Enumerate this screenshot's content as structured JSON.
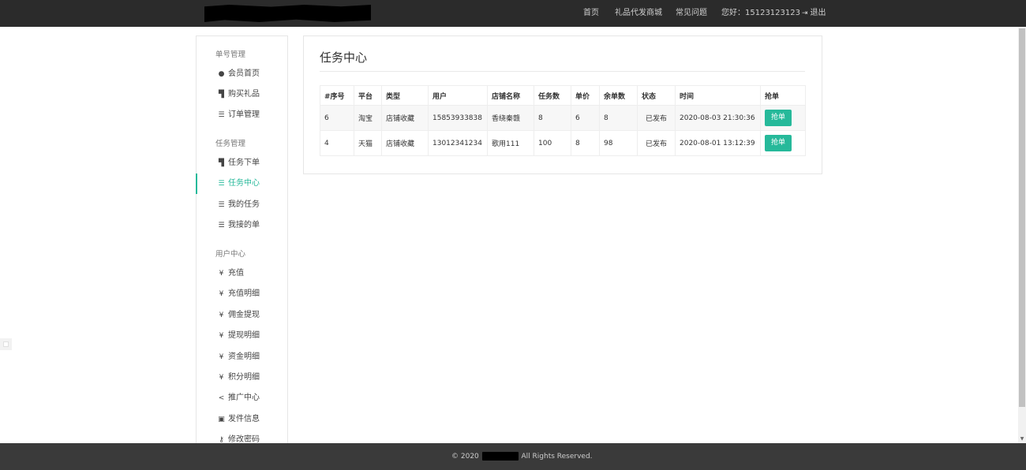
{
  "nav": {
    "items": [
      {
        "label": "首页"
      },
      {
        "label": "礼品代发商城"
      },
      {
        "label": "常见问题"
      },
      {
        "label": "您好：15123123123"
      },
      {
        "label": "退出"
      }
    ]
  },
  "sidebar": {
    "groups": [
      {
        "label": "单号管理",
        "items": [
          {
            "label": "会员首页",
            "icon": "user-circle-icon"
          },
          {
            "label": "购买礼品",
            "icon": "cart-icon"
          },
          {
            "label": "订单管理",
            "icon": "list-icon"
          }
        ]
      },
      {
        "label": "任务管理",
        "items": [
          {
            "label": "任务下单",
            "icon": "cart-icon"
          },
          {
            "label": "任务中心",
            "icon": "list-icon"
          },
          {
            "label": "我的任务",
            "icon": "list-icon"
          },
          {
            "label": "我接的单",
            "icon": "list-icon"
          }
        ]
      },
      {
        "label": "用户中心",
        "items": [
          {
            "label": "充值",
            "icon": "yen-icon"
          },
          {
            "label": "充值明细",
            "icon": "yen-icon"
          },
          {
            "label": "佣金提现",
            "icon": "yen-icon"
          },
          {
            "label": "提现明细",
            "icon": "yen-icon"
          },
          {
            "label": "资金明细",
            "icon": "yen-icon"
          },
          {
            "label": "积分明细",
            "icon": "yen-icon"
          },
          {
            "label": "推广中心",
            "icon": "share-icon"
          },
          {
            "label": "发件信息",
            "icon": "id-card-icon"
          },
          {
            "label": "修改密码",
            "icon": "key-icon"
          }
        ]
      }
    ],
    "active": "任务中心"
  },
  "main": {
    "title": "任务中心",
    "table": {
      "headers": [
        "#序号",
        "平台",
        "类型",
        "用户",
        "店铺名称",
        "任务数",
        "单价",
        "余单数",
        "状态",
        "时间",
        "抢单"
      ],
      "rows": [
        {
          "id": "6",
          "platform": "淘宝",
          "type": "店铺收藏",
          "user": "15853933838",
          "shop": "香绕秦赣",
          "count": "8",
          "price": "6",
          "remaining": "8",
          "status": "已发布",
          "time": "2020-08-03 21:30:36",
          "action": "抢单"
        },
        {
          "id": "4",
          "platform": "天猫",
          "type": "店铺收藏",
          "user": "13012341234",
          "shop": "歌用111",
          "count": "100",
          "price": "8",
          "remaining": "98",
          "status": "已发布",
          "time": "2020-08-01 13:12:39",
          "action": "抢单"
        }
      ]
    }
  },
  "footer": {
    "prefix": "© 2020",
    "suffix": "All Rights Reserved."
  },
  "colors": {
    "accent": "#26b99a",
    "navbar": "#2b2b2b",
    "footer": "#3a3a3a"
  }
}
